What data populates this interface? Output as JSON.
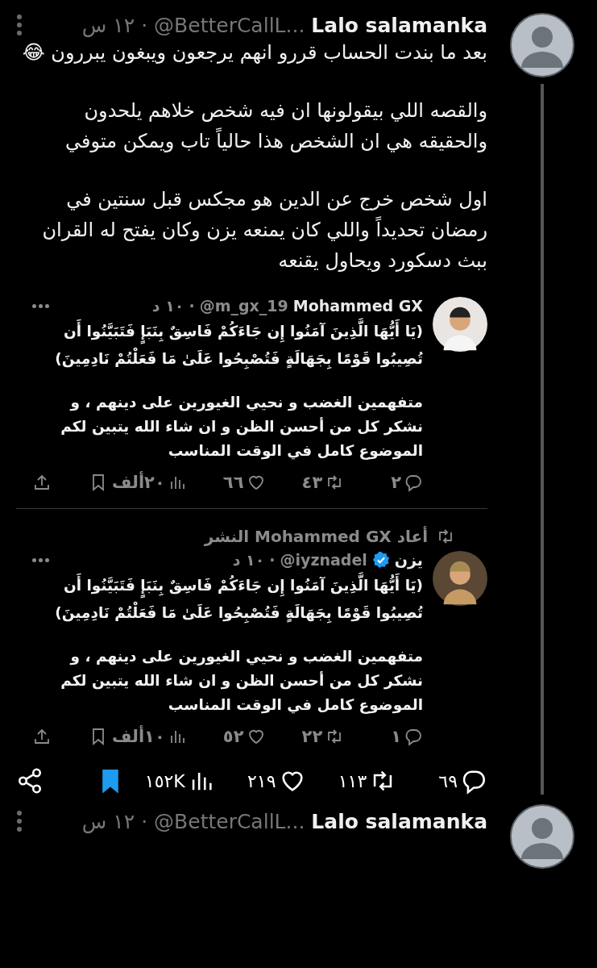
{
  "post": {
    "author": "Lalo salamanka",
    "handle": "@BetterCallL...",
    "separator": "·",
    "time": "١٢ س",
    "paragraphs": [
      "بعد ما بندت الحساب قررو انهم يرجعون ويبغون يبررون 😂",
      "والقصه اللي بيقولونها ان فيه شخص خلاهم يلحدون والحقيقه هي ان الشخص هذا حالياً تاب ويمكن متوفي",
      "اول شخص خرج عن الدين هو مجكس قبل سنتين في رمضان تحديداً واللي كان يمنعه يزن وكان يفتح له القران ببث دسكورد ويحاول يقنعه"
    ],
    "replies": [
      {
        "author": "Mohammed GX",
        "verified": false,
        "handle": "@m_gx_19",
        "separator": "·",
        "time": "١٠ د",
        "paragraphs": [
          "(يَا أَيُّهَا الَّذِينَ آمَنُوا إِن جَاءَكُمْ فَاسِقٌ بِنَبَإٍ فَتَبَيَّنُوا أَن تُصِيبُوا قَوْمًا بِجَهَالَةٍ فَتُصْبِحُوا عَلَىٰ مَا فَعَلْتُمْ نَادِمِينَ)",
          "متفهمين الغضب و نحيي الغيورين على دينهم ، و نشكر كل من أحسن الظن و ان شاء الله يتبين لكم الموضوع كامل في الوقت المناسب"
        ],
        "actions": [
          {
            "kind": "reply",
            "count": "٢"
          },
          {
            "kind": "repost",
            "count": "٤٣"
          },
          {
            "kind": "like",
            "count": "٦٦"
          },
          {
            "kind": "views",
            "count": "٢٠ألف"
          },
          {
            "kind": "bookmark",
            "on": false
          },
          {
            "kind": "share"
          }
        ]
      },
      {
        "repost_note": "أعاد Mohammed GX النشر",
        "author": "يزن",
        "verified": true,
        "handle": "@iyznadel",
        "separator": "·",
        "time": "١٠ د",
        "paragraphs": [
          "(يَا أَيُّهَا الَّذِينَ آمَنُوا إِن جَاءَكُمْ فَاسِقٌ بِنَبَإٍ فَتَبَيَّنُوا أَن تُصِيبُوا قَوْمًا بِجَهَالَةٍ فَتُصْبِحُوا عَلَىٰ مَا فَعَلْتُمْ نَادِمِينَ)",
          "متفهمين الغضب و نحيي الغيورين على دينهم ، و نشكر كل من أحسن الظن و ان شاء الله يتبين لكم الموضوع كامل في الوقت المناسب"
        ],
        "actions": [
          {
            "kind": "reply",
            "count": "١"
          },
          {
            "kind": "repost",
            "count": "٢٢"
          },
          {
            "kind": "like",
            "count": "٥٢"
          },
          {
            "kind": "views",
            "count": "١٠ألف"
          },
          {
            "kind": "bookmark",
            "on": false
          },
          {
            "kind": "share"
          }
        ]
      }
    ],
    "actions": [
      {
        "kind": "reply",
        "count": "٦٩"
      },
      {
        "kind": "repost",
        "count": "١١٣"
      },
      {
        "kind": "like",
        "count": "٢١٩"
      },
      {
        "kind": "views",
        "count": "١٥٢K"
      },
      {
        "kind": "bookmark",
        "on": true
      },
      {
        "kind": "share"
      }
    ]
  },
  "next_post": {
    "author": "Lalo salamanka",
    "handle": "@BetterCallL...",
    "separator": "·",
    "time": "١٢ س"
  }
}
